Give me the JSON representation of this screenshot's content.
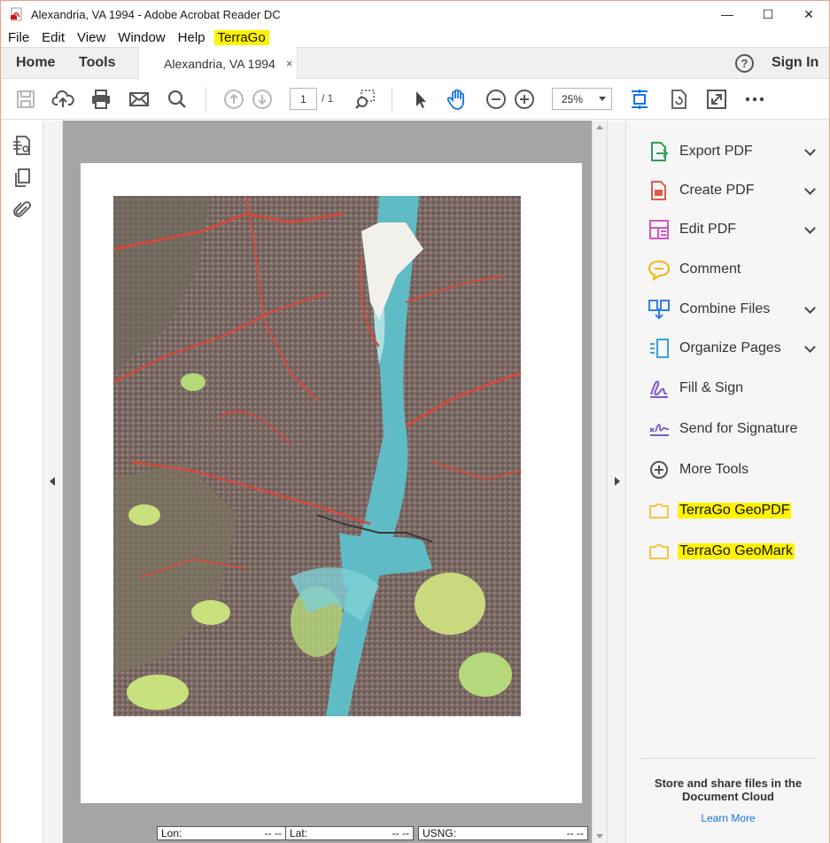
{
  "window": {
    "title": "Alexandria, VA 1994 - Adobe Acrobat Reader DC",
    "minimize": "—",
    "maximize": "☐",
    "close": "✕"
  },
  "menu": {
    "items": [
      "File",
      "Edit",
      "View",
      "Window",
      "Help"
    ],
    "highlight": "TerraGo"
  },
  "tabs": {
    "home": "Home",
    "tools": "Tools",
    "document": "Alexandria, VA 1994",
    "close": "×",
    "help": "?",
    "sign_in": "Sign In"
  },
  "toolbar": {
    "page_current": "1",
    "page_total": "/   1",
    "zoom": "25%"
  },
  "coords": {
    "lon_label": "Lon:",
    "lon_value": "-- --",
    "lat_label": "Lat:",
    "lat_value": "-- --",
    "usng_label": "USNG:",
    "usng_value": "-- --"
  },
  "tools": [
    {
      "label": "Export PDF",
      "icon": "export-pdf-icon",
      "chevron": true
    },
    {
      "label": "Create PDF",
      "icon": "create-pdf-icon",
      "chevron": true
    },
    {
      "label": "Edit PDF",
      "icon": "edit-pdf-icon",
      "chevron": true
    },
    {
      "label": "Comment",
      "icon": "comment-icon",
      "chevron": false
    },
    {
      "label": "Combine Files",
      "icon": "combine-files-icon",
      "chevron": true
    },
    {
      "label": "Organize Pages",
      "icon": "organize-pages-icon",
      "chevron": true
    },
    {
      "label": "Fill & Sign",
      "icon": "fill-sign-icon",
      "chevron": false
    },
    {
      "label": "Send for Signature",
      "icon": "send-signature-icon",
      "chevron": false
    },
    {
      "label": "More Tools",
      "icon": "more-tools-icon",
      "chevron": false
    },
    {
      "label": "TerraGo GeoPDF",
      "icon": "folder-icon",
      "chevron": false
    },
    {
      "label": "TerraGo GeoMark",
      "icon": "folder-icon",
      "chevron": false
    }
  ],
  "promo": {
    "text": "Store and share files in the Document Cloud",
    "link": "Learn More"
  },
  "colors": {
    "accent": "#1473e6",
    "highlight": "#fff200"
  }
}
